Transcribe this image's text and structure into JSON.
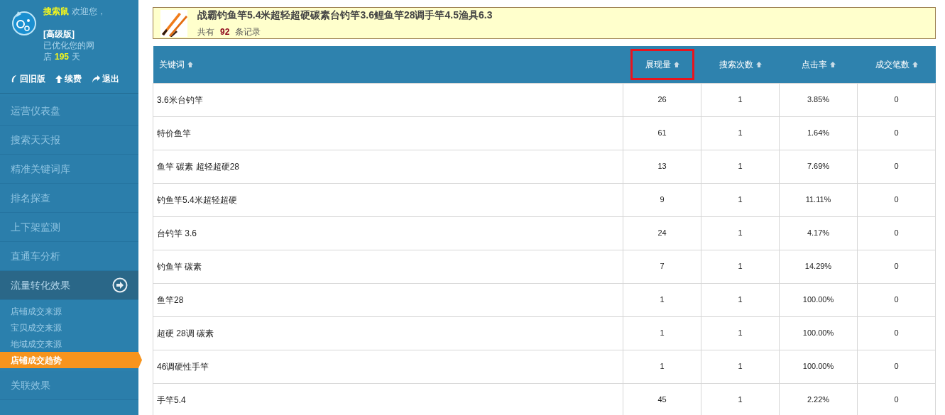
{
  "sidebar": {
    "user": {
      "name": "搜索鼠",
      "greeting": "欢迎您，",
      "edition": "[高级版]",
      "status_line": "已优化您的网",
      "days_prefix": "店",
      "days": "195",
      "days_suffix": "天"
    },
    "links": [
      {
        "label": "回旧版",
        "kind": "leaf"
      },
      {
        "label": "续费",
        "kind": "up"
      },
      {
        "label": "退出",
        "kind": "exit"
      }
    ],
    "menu": [
      {
        "label": "运营仪表盘",
        "expanded": false
      },
      {
        "label": "搜索天天报",
        "expanded": false
      },
      {
        "label": "精准关键词库",
        "expanded": false
      },
      {
        "label": "排名探查",
        "expanded": false
      },
      {
        "label": "上下架监测",
        "expanded": false
      },
      {
        "label": "直通车分析",
        "expanded": false
      },
      {
        "label": "流量转化效果",
        "expanded": true,
        "children": [
          {
            "label": "店铺成交来源",
            "selected": false
          },
          {
            "label": "宝贝成交来源",
            "selected": false
          },
          {
            "label": "地域成交来源",
            "selected": false
          },
          {
            "label": "店铺成交趋势",
            "selected": true
          }
        ]
      },
      {
        "label": "关联效果",
        "expanded": false
      }
    ]
  },
  "product": {
    "title": "战霸钓鱼竿5.4米超轻超硬碳素台钓竿3.6鲤鱼竿28调手竿4.5渔具6.3",
    "count_prefix": "共有",
    "count": "92",
    "count_suffix": "条记录"
  },
  "table": {
    "columns": [
      {
        "label": "关键词",
        "highlighted": false
      },
      {
        "label": "展现量",
        "highlighted": true
      },
      {
        "label": "搜索次数",
        "highlighted": false
      },
      {
        "label": "点击率",
        "highlighted": false
      },
      {
        "label": "成交笔数",
        "highlighted": false
      }
    ],
    "rows": [
      [
        "3.6米台钓竿",
        "26",
        "1",
        "3.85%",
        "0"
      ],
      [
        "特价鱼竿",
        "61",
        "1",
        "1.64%",
        "0"
      ],
      [
        "鱼竿 碳素 超轻超硬28",
        "13",
        "1",
        "7.69%",
        "0"
      ],
      [
        "钓鱼竿5.4米超轻超硬",
        "9",
        "1",
        "11.11%",
        "0"
      ],
      [
        "台钓竿 3.6",
        "24",
        "1",
        "4.17%",
        "0"
      ],
      [
        "钓鱼竿 碳素",
        "7",
        "1",
        "14.29%",
        "0"
      ],
      [
        "鱼竿28",
        "1",
        "1",
        "100.00%",
        "0"
      ],
      [
        "超硬 28调 碳素",
        "1",
        "1",
        "100.00%",
        "0"
      ],
      [
        "46调硬性手竿",
        "1",
        "1",
        "100.00%",
        "0"
      ],
      [
        "手竿5.4",
        "45",
        "1",
        "2.22%",
        "0"
      ]
    ]
  }
}
